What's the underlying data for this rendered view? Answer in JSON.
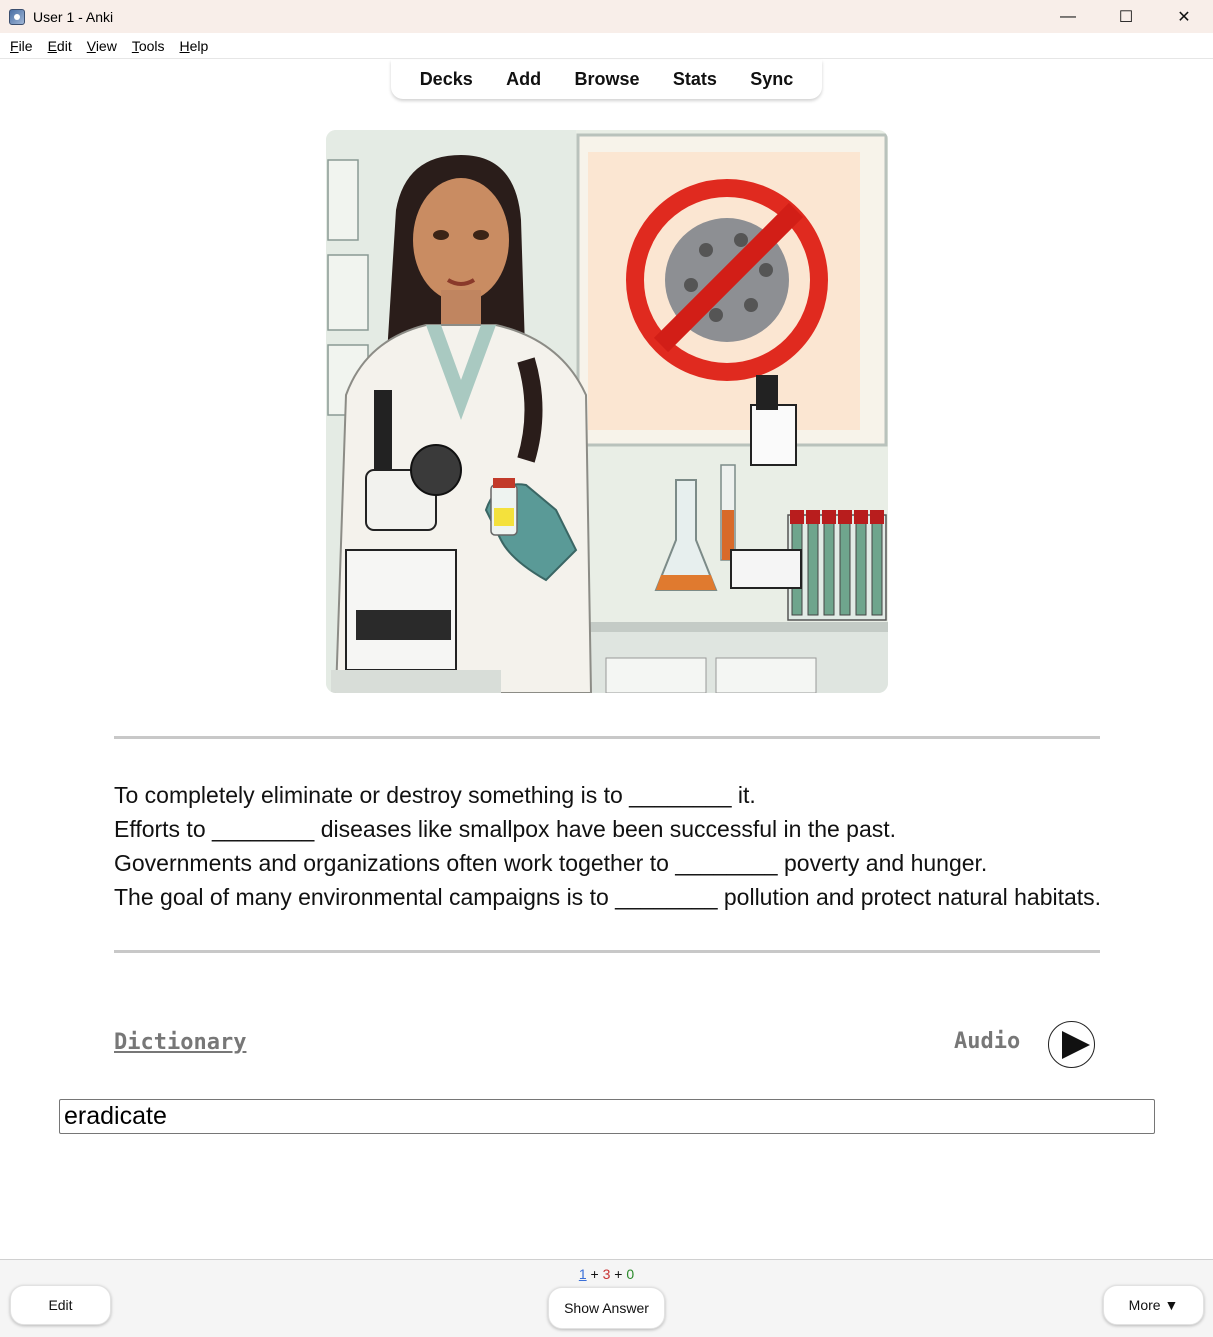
{
  "window": {
    "title": "User 1 - Anki",
    "controls": {
      "minimize": "—",
      "maximize": "☐",
      "close": "✕"
    }
  },
  "menu": [
    {
      "accel": "F",
      "rest": "ile"
    },
    {
      "accel": "E",
      "rest": "dit"
    },
    {
      "accel": "V",
      "rest": "iew"
    },
    {
      "accel": "T",
      "rest": "ools"
    },
    {
      "accel": "H",
      "rest": "elp"
    }
  ],
  "toolbar": {
    "decks": "Decks",
    "add": "Add",
    "browse": "Browse",
    "stats": "Stats",
    "sync": "Sync"
  },
  "card": {
    "image_icon": "scientist-lab-illustration",
    "sentences": [
      "To completely eliminate or destroy something is to ________ it.",
      "Efforts to ________ diseases like smallpox have been successful in the past.",
      "Governments and organizations often work together to ________ poverty and hunger.",
      "The goal of many environmental campaigns is to ________ pollution and protect natural habitats."
    ],
    "dictionary_label": "Dictionary",
    "audio_label": "Audio",
    "play_icon": "play-icon",
    "typed_answer": "eradicate"
  },
  "bottom": {
    "count_new": "1",
    "count_learn": "3",
    "count_review": "0",
    "plus": "+",
    "edit_label": "Edit",
    "show_answer_label": "Show Answer",
    "more_label": "More ▼"
  },
  "colors": {
    "new": "#3a6fd8",
    "learn": "#c83333",
    "review": "#2a8a2a"
  }
}
